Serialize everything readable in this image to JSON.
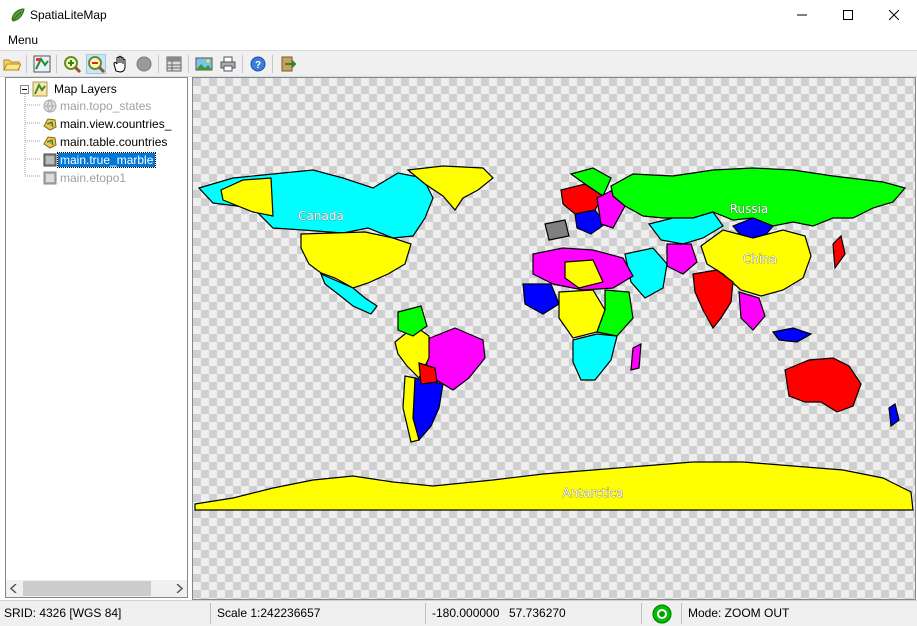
{
  "window": {
    "title": "SpatiaLiteMap"
  },
  "menu": {
    "label": "Menu"
  },
  "toolbar": {
    "buttons": [
      "open-folder-icon",
      "layer-config-icon",
      "zoom-in-icon",
      "zoom-out-icon",
      "pan-hand-icon",
      "stop-icon",
      "table-icon",
      "image-export-icon",
      "print-icon",
      "help-icon",
      "exit-icon"
    ],
    "active": "zoom-out-icon"
  },
  "tree": {
    "root": "Map Layers",
    "layers": [
      {
        "label": "main.topo_states",
        "state": "disabled"
      },
      {
        "label": "main.view.countries_",
        "state": "normal"
      },
      {
        "label": "main.table.countries",
        "state": "normal"
      },
      {
        "label": "main.true_marble",
        "state": "selected"
      },
      {
        "label": "main.etopo1",
        "state": "disabled"
      }
    ]
  },
  "map": {
    "labels": {
      "canada": "Canada",
      "russia": "Russia",
      "china": "China",
      "antarctica": "Antarctica"
    },
    "colors": {
      "yellow": "#ffff00",
      "cyan": "#00ffff",
      "green": "#00ff00",
      "red": "#ff0000",
      "magenta": "#ff00ff",
      "blue": "#0000ff"
    }
  },
  "status": {
    "srid": "SRID: 4326 [WGS 84]",
    "scale": "Scale 1:242236657",
    "x": "-180.000000",
    "y": "57.736270",
    "mode": "Mode: ZOOM OUT"
  }
}
